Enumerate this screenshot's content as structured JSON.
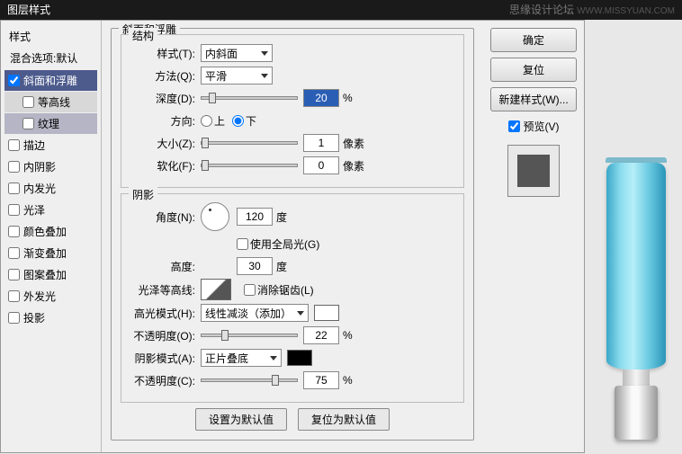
{
  "title": "图层样式",
  "watermark": {
    "text": "思缘设计论坛",
    "url": "WWW.MISSYUAN.COM"
  },
  "sidebar": {
    "header": "样式",
    "blend": "混合选项:默认",
    "items": [
      {
        "label": "斜面和浮雕",
        "checked": true,
        "selected": true
      },
      {
        "label": "等高线",
        "sub": true,
        "checked": false
      },
      {
        "label": "纹理",
        "sub": true,
        "checked": false,
        "active": true
      },
      {
        "label": "描边",
        "checked": false
      },
      {
        "label": "内阴影",
        "checked": false
      },
      {
        "label": "内发光",
        "checked": false
      },
      {
        "label": "光泽",
        "checked": false
      },
      {
        "label": "颜色叠加",
        "checked": false
      },
      {
        "label": "渐变叠加",
        "checked": false
      },
      {
        "label": "图案叠加",
        "checked": false
      },
      {
        "label": "外发光",
        "checked": false
      },
      {
        "label": "投影",
        "checked": false
      }
    ]
  },
  "content": {
    "bevel_legend": "斜面和浮雕",
    "struct_legend": "结构",
    "style_label": "样式(T):",
    "style_value": "内斜面",
    "method_label": "方法(Q):",
    "method_value": "平滑",
    "depth_label": "深度(D):",
    "depth_value": "20",
    "percent": "%",
    "direction_label": "方向:",
    "dir_up": "上",
    "dir_down": "下",
    "size_label": "大小(Z):",
    "size_value": "1",
    "px": "像素",
    "soft_label": "软化(F):",
    "soft_value": "0",
    "shade_legend": "阴影",
    "angle_label": "角度(N):",
    "angle_value": "120",
    "deg": "度",
    "global_label": "使用全局光(G)",
    "altitude_label": "高度:",
    "altitude_value": "30",
    "gloss_label": "光泽等高线:",
    "anti_label": "消除锯齿(L)",
    "hmode_label": "高光模式(H):",
    "hmode_value": "线性减淡（添加）",
    "hop_label": "不透明度(O):",
    "hop_value": "22",
    "smode_label": "阴影模式(A):",
    "smode_value": "正片叠底",
    "sop_label": "不透明度(C):",
    "sop_value": "75",
    "btn_default": "设置为默认值",
    "btn_reset": "复位为默认值"
  },
  "right": {
    "ok": "确定",
    "cancel": "复位",
    "new_style": "新建样式(W)...",
    "preview": "预览(V)"
  }
}
